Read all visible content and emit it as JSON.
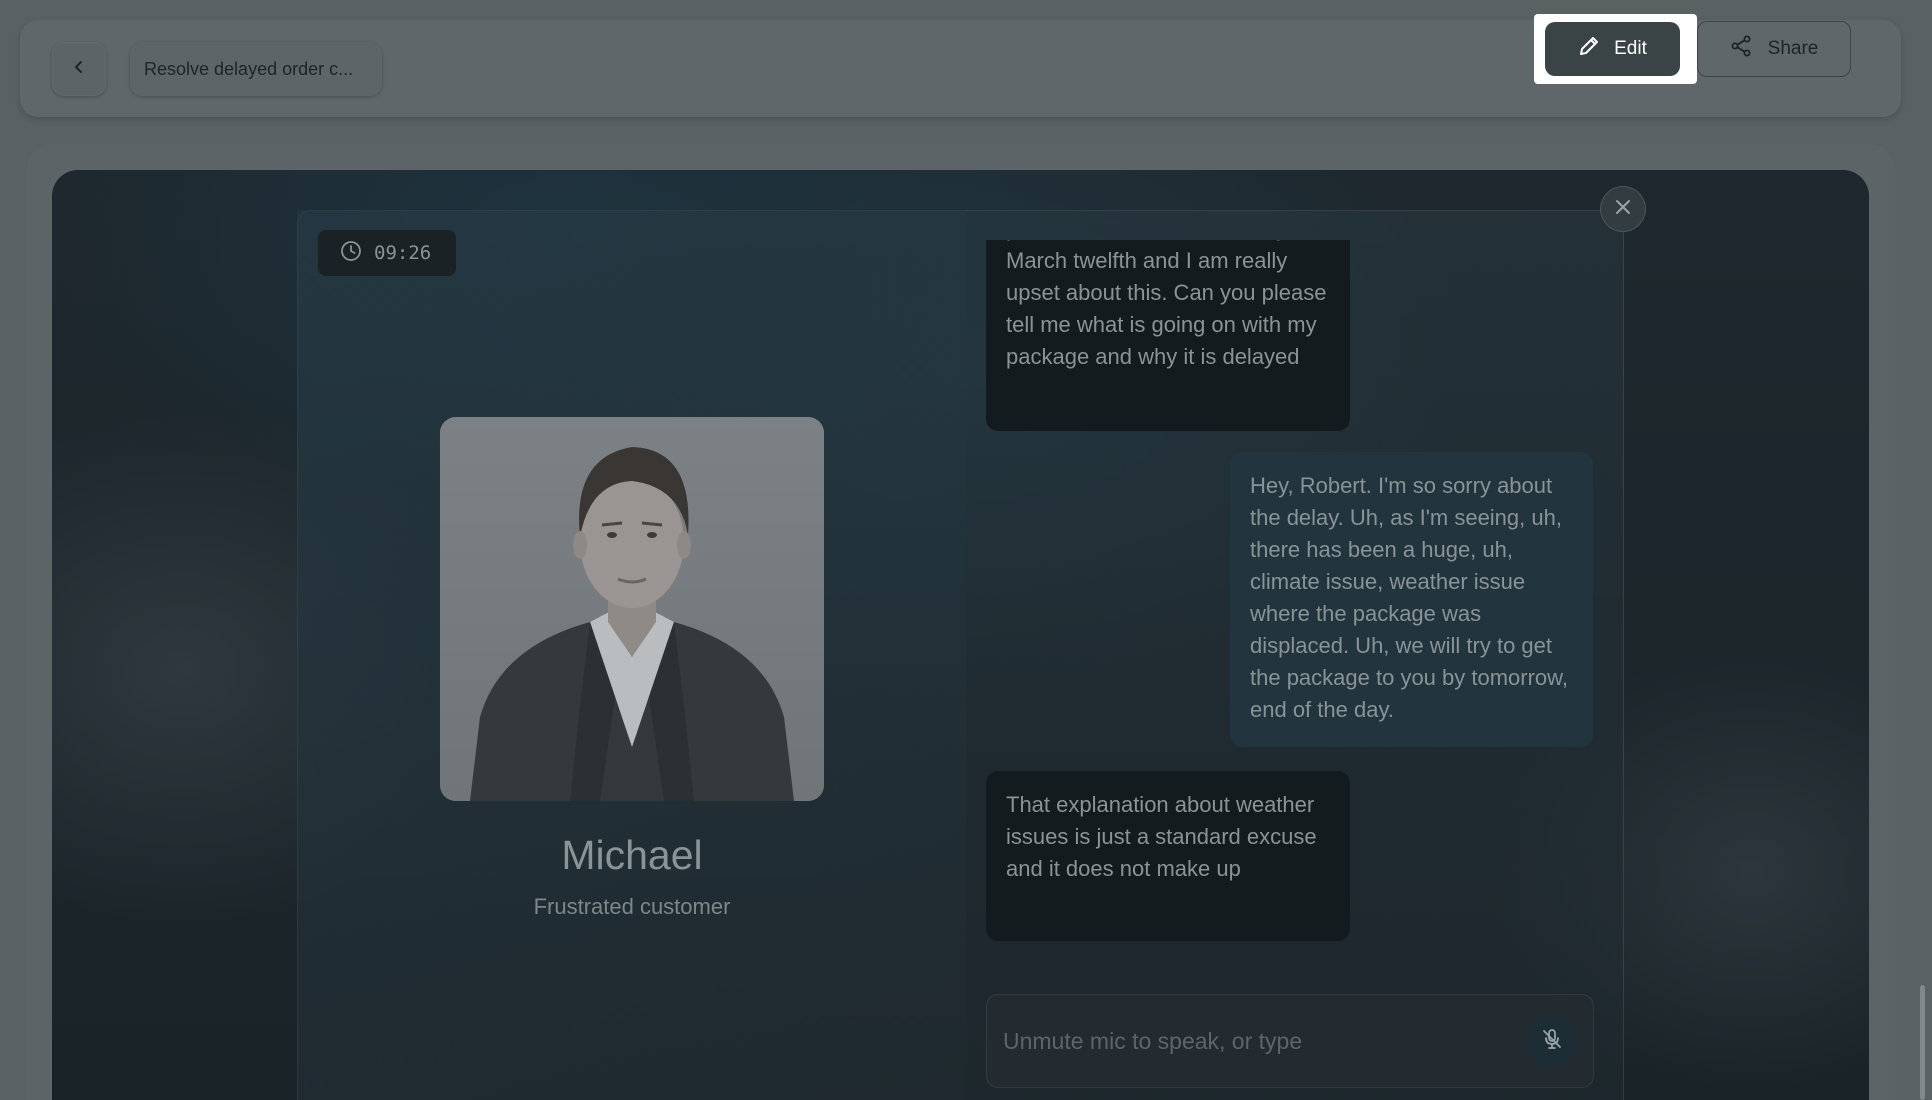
{
  "header": {
    "back_icon": "chevron-left-icon",
    "title": "Resolve delayed order c...",
    "edit_label": "Edit",
    "edit_icon": "pencil-icon",
    "share_label": "Share",
    "share_icon": "share-icon"
  },
  "call": {
    "timer": "09:26",
    "timer_icon": "clock-icon",
    "persona": {
      "name": "Michael",
      "role": "Frustrated customer"
    },
    "close_icon": "close-icon",
    "messages": [
      {
        "sender": "persona",
        "text": "promised it would be here by March twelfth and I am really upset about this. Can you please tell me what is going on with my package and why it is delayed"
      },
      {
        "sender": "user",
        "text": "Hey, Robert. I'm so sorry about the delay. Uh, as I'm seeing, uh, there has been a huge, uh, climate issue, weather issue where the package was displaced. Uh, we will try to get the package to you by tomorrow, end of the day."
      },
      {
        "sender": "persona",
        "text": "That explanation about weather issues is just a standard excuse and it does not make up"
      }
    ],
    "input": {
      "placeholder": "Unmute mic to speak, or type",
      "value": ""
    },
    "mic_icon": "mic-off-icon"
  },
  "colors": {
    "overlay": "#5a6163",
    "stage_bg": "#1e282e",
    "persona_bubble": "#141b1f",
    "user_bubble": "#22343e",
    "edit_button": "#3a4346"
  }
}
